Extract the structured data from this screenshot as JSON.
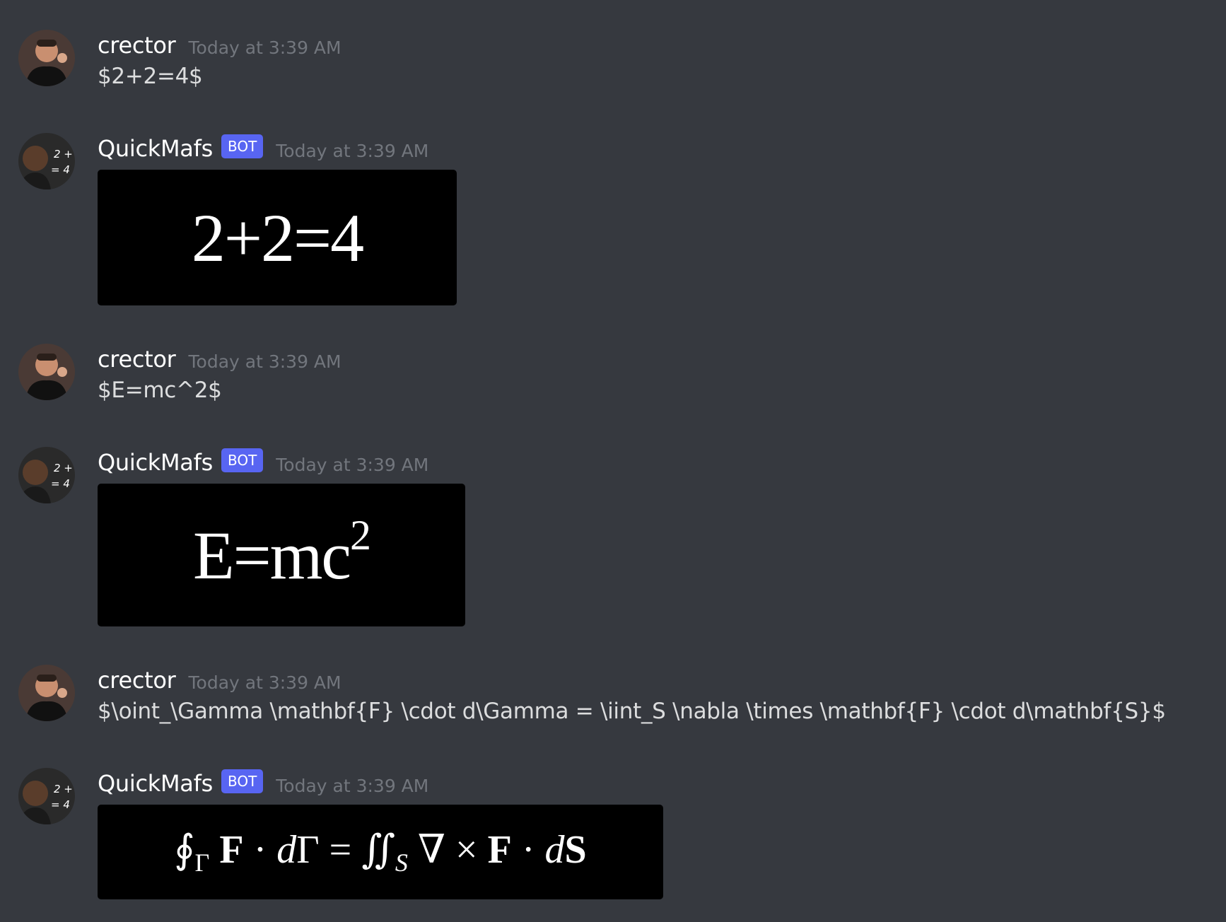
{
  "messages": [
    {
      "author": "crector",
      "timestamp": "Today at 3:39 AM",
      "text": "$2+2=4$"
    },
    {
      "author": "QuickMafs",
      "badge": "BOT",
      "timestamp": "Today at 3:39 AM",
      "rendered": "2+2=4"
    },
    {
      "author": "crector",
      "timestamp": "Today at 3:39 AM",
      "text": "$E=mc^2$"
    },
    {
      "author": "QuickMafs",
      "badge": "BOT",
      "timestamp": "Today at 3:39 AM",
      "rendered_base": "E=mc",
      "rendered_sup": "2"
    },
    {
      "author": "crector",
      "timestamp": "Today at 3:39 AM",
      "text": "$\\oint_\\Gamma \\mathbf{F} \\cdot d\\Gamma = \\iint_S \\nabla \\times \\mathbf{F} \\cdot d\\mathbf{S}$"
    },
    {
      "author": "QuickMafs",
      "badge": "BOT",
      "timestamp": "Today at 3:39 AM",
      "rendered_parts": {
        "oint": "∮",
        "sub_gamma": "Γ",
        "F1": "F",
        "dot1": "·",
        "d1": "d",
        "gamma": "Γ",
        "eq": "=",
        "iint": "∬",
        "sub_s": "S",
        "nabla": "∇",
        "times": "×",
        "F2": "F",
        "dot2": "·",
        "d2": "d",
        "S": "S"
      }
    }
  ],
  "colors": {
    "background": "#36393f",
    "username": "#ffffff",
    "timestamp": "#72767d",
    "message_text": "#dcddde",
    "bot_badge": "#5865f2",
    "latex_background": "#000000"
  }
}
